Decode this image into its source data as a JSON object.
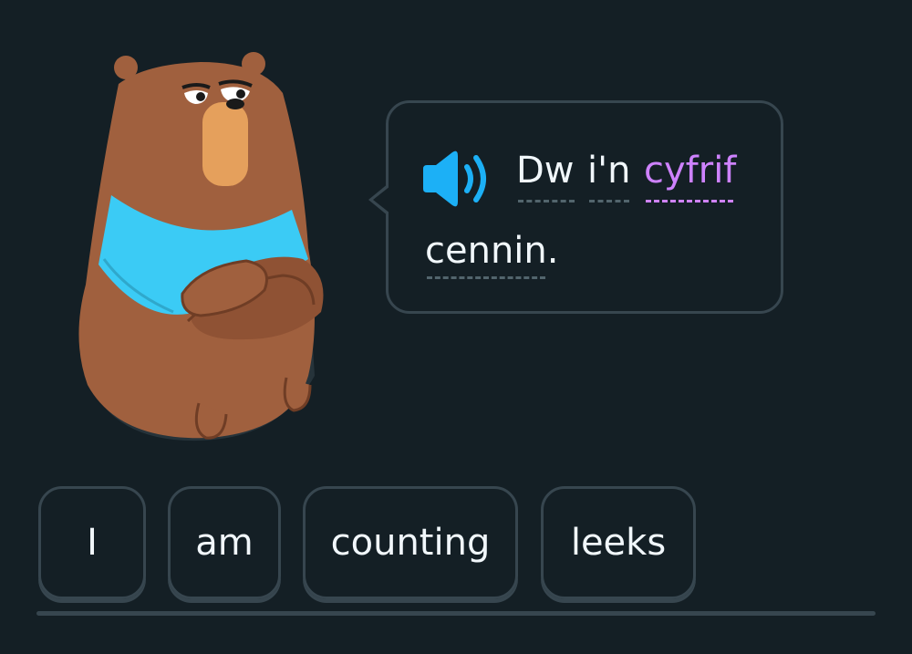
{
  "bubble": {
    "speaker_icon": "speaker-icon",
    "words": [
      "Dw",
      "i'n",
      "cyfrif",
      "cennin."
    ],
    "highlighted_word": "cyfrif"
  },
  "answer_tiles": [
    "I",
    "am",
    "counting",
    "leeks"
  ],
  "colors": {
    "background": "#141f25",
    "border": "#37464f",
    "text": "#f1f7fb",
    "highlight": "#ce82ff",
    "speaker": "#1cb0f6",
    "bear_fur": "#a0603e",
    "bear_scarf": "#3bcbf5"
  }
}
